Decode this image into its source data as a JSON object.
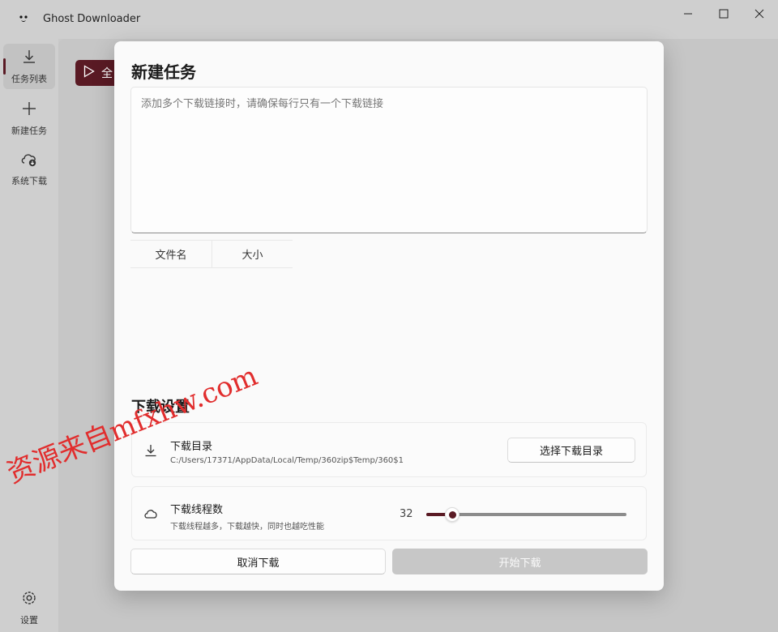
{
  "window": {
    "title": "Ghost Downloader"
  },
  "sidebar": {
    "items": [
      {
        "label": "任务列表",
        "icon": "download-icon",
        "active": true
      },
      {
        "label": "新建任务",
        "icon": "plus-icon",
        "active": false
      },
      {
        "label": "系统下载",
        "icon": "cloud-download-icon",
        "active": false
      }
    ],
    "settings_label": "设置"
  },
  "background": {
    "play_button_label": "全"
  },
  "dialog": {
    "title": "新建任务",
    "url_placeholder": "添加多个下载链接时，请确保每行只有一个下载链接",
    "table_columns": [
      "文件名",
      "大小"
    ],
    "settings_title": "下载设置",
    "download_dir": {
      "title": "下载目录",
      "path": "C:/Users/17371/AppData/Local/Temp/360zip$Temp/360$1",
      "button_label": "选择下载目录"
    },
    "threads": {
      "title": "下载线程数",
      "description": "下载线程越多，下载越快，同时也越吃性能",
      "value": "32",
      "fraction": 0.13
    },
    "cancel_label": "取消下载",
    "start_label": "开始下载"
  },
  "watermark": "资源来自mfxhw.com",
  "colors": {
    "accent": "#5a1a24",
    "disabled_button": "#c7c7c7",
    "watermark": "#e12d2d"
  }
}
